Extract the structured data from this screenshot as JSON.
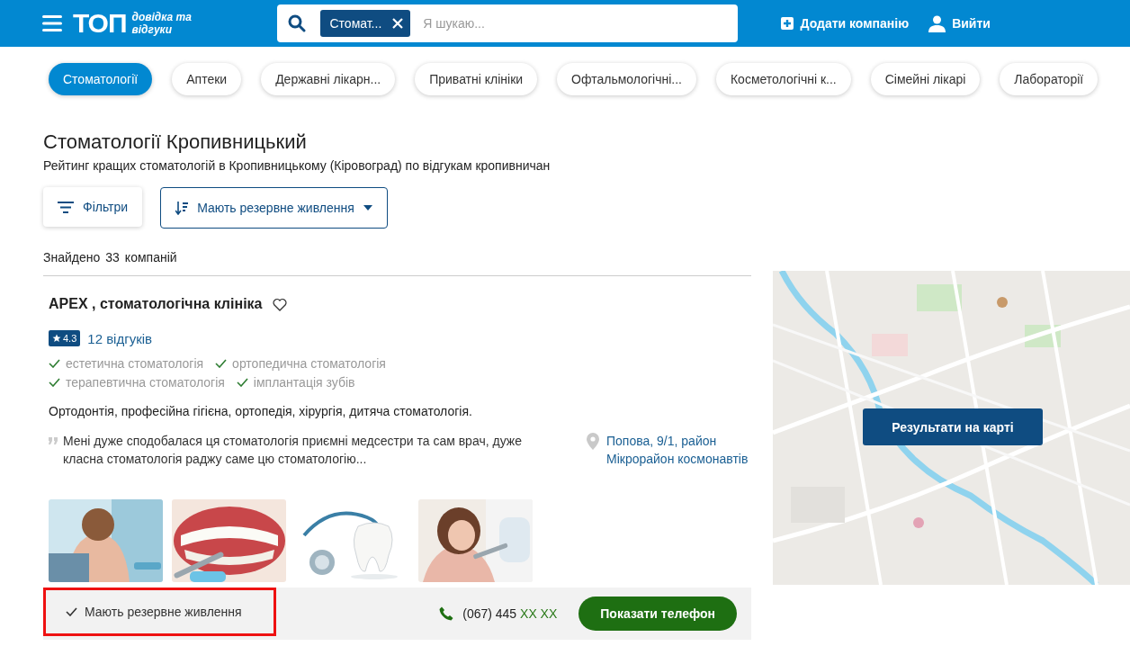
{
  "header": {
    "logo": "ТОП",
    "tagline": "довідка та відгуки",
    "search": {
      "chip": "Стомат...",
      "placeholder": "Я шукаю..."
    },
    "add_company": "Додати компанію",
    "logout": "Вийти"
  },
  "categories": [
    {
      "label": "Стоматології",
      "selected": true
    },
    {
      "label": "Аптеки",
      "selected": false
    },
    {
      "label": "Державні лікарн...",
      "selected": false
    },
    {
      "label": "Приватні клініки",
      "selected": false
    },
    {
      "label": "Офтальмологічні...",
      "selected": false
    },
    {
      "label": "Косметологічні к...",
      "selected": false
    },
    {
      "label": "Сімейні лікарі",
      "selected": false
    },
    {
      "label": "Лабораторії",
      "selected": false
    }
  ],
  "page": {
    "title": "Стоматології Кропивницький",
    "subtitle": "Рейтинг кращих стоматологій в Кропивницькому (Кіровоград) по відгукам кропивничан"
  },
  "toolbar": {
    "filters": "Фільтри",
    "sort": "Мають резервне живлення"
  },
  "found": {
    "label": "Знайдено",
    "count": "33",
    "unit": "компаній"
  },
  "companies": [
    {
      "name": "APEX , стоматологічна клініка",
      "favorite": false,
      "rating": "4.3",
      "reviews": "12 відгуків",
      "services": [
        "естетична стоматологія",
        "ортопедична стоматологія",
        "терапевтична стоматологія",
        "імплантація зубів"
      ],
      "description": "Ортодонтія, професійна гігієна, ортопедія, хірургія, дитяча стоматологія.",
      "review": "Мені дуже сподобалася ця стоматологія приємні медсестри та сам врач, дуже класна стоматологія раджу саме цю стоматологію...",
      "address": "Попова, 9/1, район Мікрорайон космонавтів",
      "feature": {
        "label": "Мають резервне живлення",
        "highlighted": true
      },
      "phone": {
        "visible": "(067) 445",
        "hidden": "XX XX"
      },
      "show_phone": "Показати телефон"
    }
  ],
  "map": {
    "kind": "picture",
    "button": "Результати на карті"
  }
}
